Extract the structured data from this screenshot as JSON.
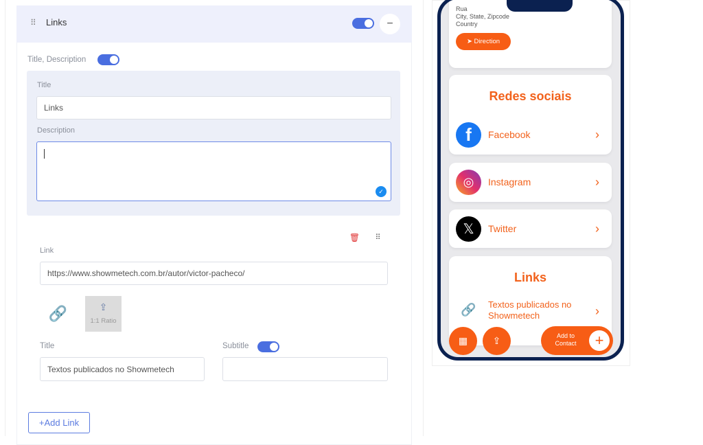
{
  "editor": {
    "section_title": "Links",
    "section_enabled": true,
    "title_desc_label": "Title, Description",
    "title_desc_enabled": true,
    "title_label": "Title",
    "title_value": "Links",
    "description_label": "Description",
    "description_value": "",
    "link_item": {
      "link_label": "Link",
      "link_value": "https://www.showmetech.com.br/autor/victor-pacheco/",
      "upload_ratio": "1:1 Ratio",
      "title_label": "Title",
      "title_value": "Textos publicados no Showmetech",
      "subtitle_label": "Subtitle",
      "subtitle_enabled": true,
      "subtitle_value": ""
    },
    "add_link_label": "Add Link"
  },
  "preview": {
    "address": [
      "Rua",
      "City, State, Zipcode",
      "Country"
    ],
    "direction_label": "Direction",
    "social_title": "Redes sociais",
    "social": [
      {
        "label": "Facebook",
        "icon": "facebook-icon"
      },
      {
        "label": "Instagram",
        "icon": "instagram-icon"
      },
      {
        "label": "Twitter",
        "icon": "x-twitter-icon"
      }
    ],
    "links_title": "Links",
    "link_item_label": "Textos publicados no Showmetech",
    "add_contact_label": "Add to Contact",
    "accent": "#f2621c",
    "frame_color": "#0b2150"
  },
  "colors": {
    "toggle": "#4a6ee0",
    "header_bg": "#eef0fc"
  }
}
